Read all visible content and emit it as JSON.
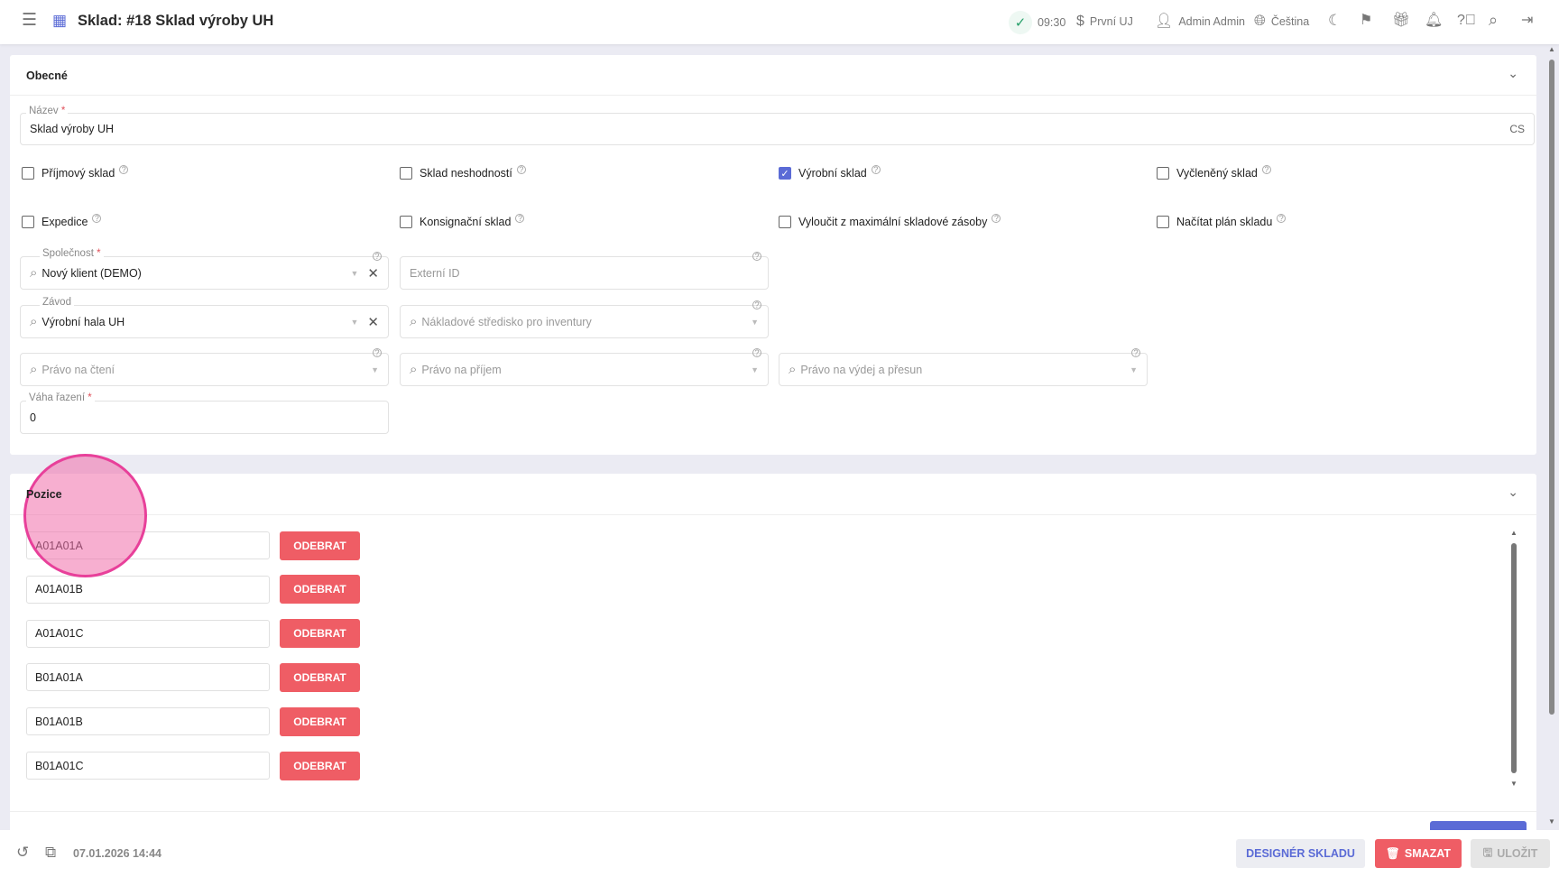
{
  "header": {
    "title": "Sklad: #18 Sklad výroby UH",
    "time": "09:30",
    "company": "První UJ",
    "user": "Admin Admin",
    "language": "Čeština"
  },
  "general": {
    "title": "Obecné",
    "name_label": "Název",
    "name_value": "Sklad výroby UH",
    "lang_code": "CS",
    "checkboxes": [
      {
        "label": "Příjmový sklad",
        "checked": false
      },
      {
        "label": "Sklad neshodností",
        "checked": false
      },
      {
        "label": "Výrobní sklad",
        "checked": true
      },
      {
        "label": "Vyčleněný sklad",
        "checked": false
      },
      {
        "label": "Expedice",
        "checked": false
      },
      {
        "label": "Konsignační sklad",
        "checked": false
      },
      {
        "label": "Vyloučit z maximální skladové zásoby",
        "checked": false
      },
      {
        "label": "Načítat plán skladu",
        "checked": false
      }
    ],
    "company_label": "Společnost",
    "company_value": "Nový klient (DEMO)",
    "external_id_placeholder": "Externí ID",
    "plant_label": "Závod",
    "plant_value": "Výrobní hala UH",
    "cost_center_placeholder": "Nákladové středisko pro inventury",
    "read_right_placeholder": "Právo na čtení",
    "receive_right_placeholder": "Právo na příjem",
    "issue_right_placeholder": "Právo na výdej a přesun",
    "sort_weight_label": "Váha řazení",
    "sort_weight_value": "0"
  },
  "positions": {
    "title": "Pozice",
    "remove_label": "ODEBRAT",
    "items": [
      "A01A01A",
      "A01A01B",
      "A01A01C",
      "B01A01A",
      "B01A01B",
      "B01A01C"
    ]
  },
  "footer": {
    "timestamp": "07.01.2026 14:44",
    "designer_label": "DESIGNÉR SKLADU",
    "delete_label": "SMAZAT",
    "save_label": "ULOŽIT"
  },
  "colors": {
    "accent": "#5b6bd6",
    "danger": "#ef5d65",
    "click_marker": "#e8409a"
  }
}
